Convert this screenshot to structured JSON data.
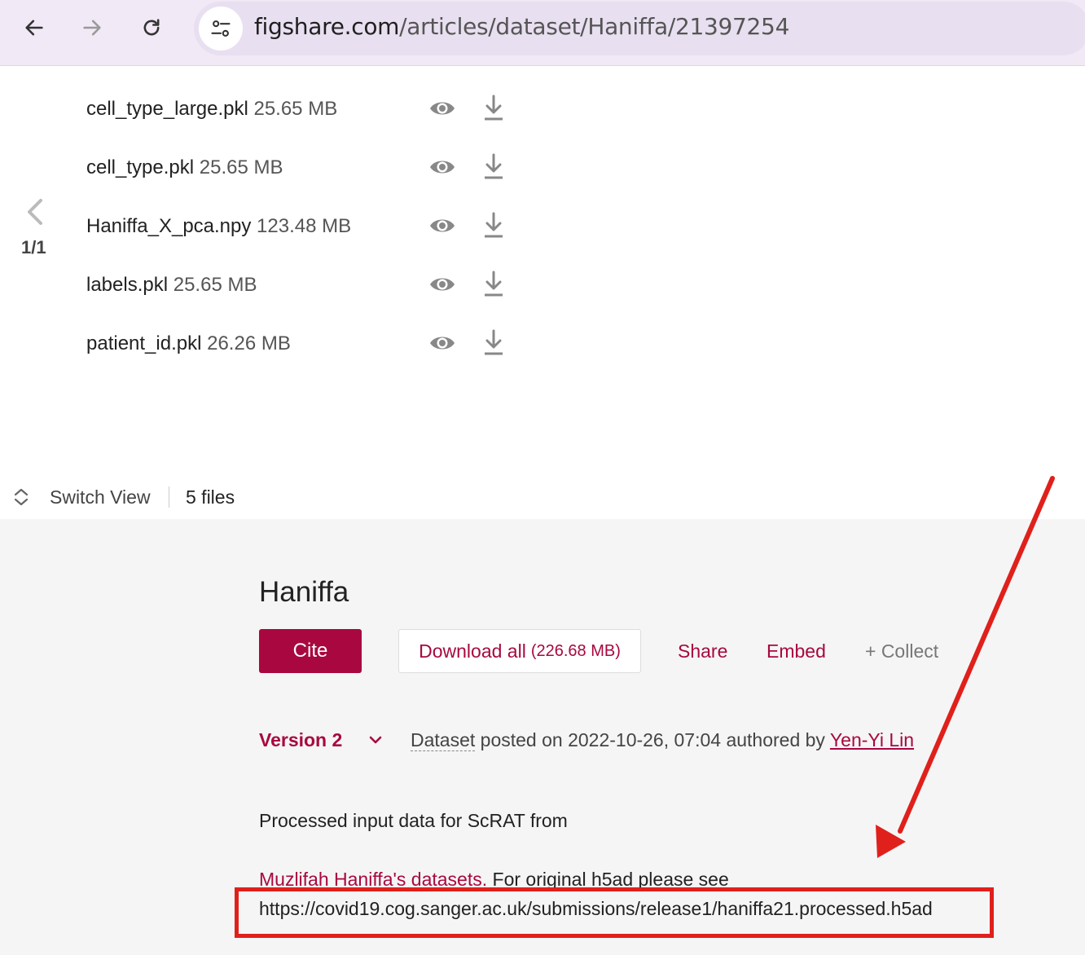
{
  "browser": {
    "url_host": "figshare.com",
    "url_path": "/articles/dataset/Haniffa/21397254",
    "icons": [
      "back-arrow-icon",
      "forward-arrow-icon",
      "reload-icon",
      "site-settings-icon"
    ]
  },
  "files": [
    {
      "name": "cell_type_large.pkl",
      "size": "25.65 MB"
    },
    {
      "name": "cell_type.pkl",
      "size": "25.65 MB"
    },
    {
      "name": "Haniffa_X_pca.npy",
      "size": "123.48 MB"
    },
    {
      "name": "labels.pkl",
      "size": "25.65 MB"
    },
    {
      "name": "patient_id.pkl",
      "size": "26.26 MB"
    }
  ],
  "pager": {
    "count": "1/1"
  },
  "switch_view": {
    "label": "Switch View",
    "files_count": "5 files"
  },
  "article": {
    "title": "Haniffa",
    "cite_label": "Cite",
    "download_label": "Download all",
    "download_size": "(226.68 MB)",
    "share_label": "Share",
    "embed_label": "Embed",
    "collect_label": "+ Collect",
    "version_label": "Version 2",
    "type": "Dataset",
    "posted_text": " posted on 2022-10-26, 07:04 authored by ",
    "author": "Yen-Yi Lin",
    "desc_line1": "Processed input data for ScRAT from",
    "desc_link": "Muzlifah Haniffa's datasets.",
    "desc_line2_rest": " For original h5ad please see",
    "desc_url": "https://covid19.cog.sanger.ac.uk/submissions/release1/haniffa21.processed.h5ad"
  },
  "colors": {
    "accent": "#a8083f",
    "annotation_red": "#e0201b",
    "details_bg": "#f5f5f5"
  }
}
